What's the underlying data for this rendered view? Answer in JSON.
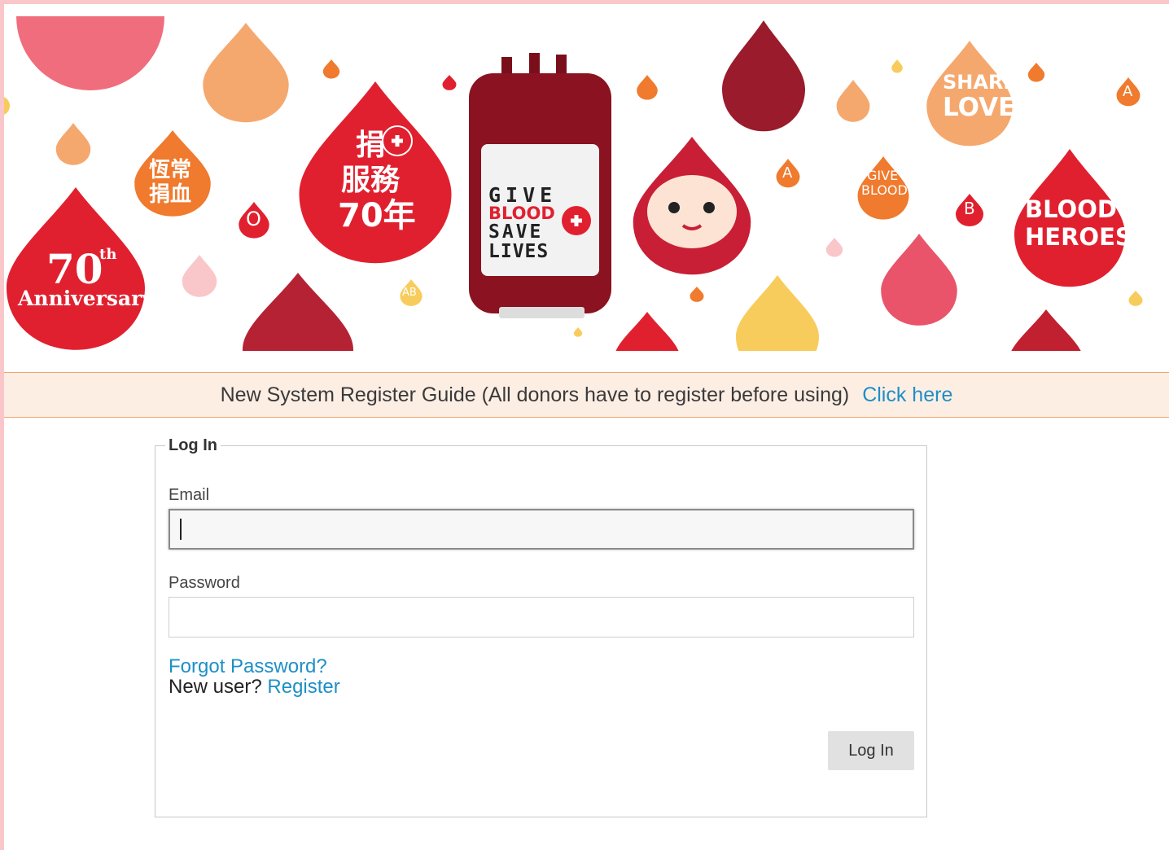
{
  "banner": {
    "text_ch_1": "捐",
    "text_ch_2": "服務",
    "text_ch_3": "70年",
    "text_chang": "恆常",
    "text_juanxue": "捐血",
    "text_anniv_num": "70",
    "text_anniv_sup": "th",
    "text_anniv_word": "Anniversary",
    "bag_give": "GIVE",
    "bag_blood": "BLOOD",
    "bag_save": "SAVE",
    "bag_lives": "LIVES",
    "share": "SHARE",
    "love": "LOVE",
    "give_small": "GIVE",
    "blood_small": "BLOOD",
    "heroes_1": "BLOOD",
    "heroes_2": "HEROES",
    "type_o": "O",
    "type_a1": "A",
    "type_a2": "A",
    "type_b": "B",
    "type_ab": "AB",
    "colors": {
      "red": "#e1202f",
      "dark_red": "#9a1b2c",
      "orange": "#f07a2d",
      "peach": "#f5a86e",
      "pink": "#f06d7d",
      "yellow": "#f8cc5c",
      "light_pink": "#f9c6c9"
    }
  },
  "guide": {
    "text": "New System Register Guide (All donors have to register before using)",
    "link": "Click here"
  },
  "login": {
    "legend": "Log In",
    "email_label": "Email",
    "email_value": "",
    "password_label": "Password",
    "password_value": "",
    "forgot": "Forgot Password?",
    "new_user": "New user?",
    "register": "Register",
    "submit": "Log In"
  }
}
